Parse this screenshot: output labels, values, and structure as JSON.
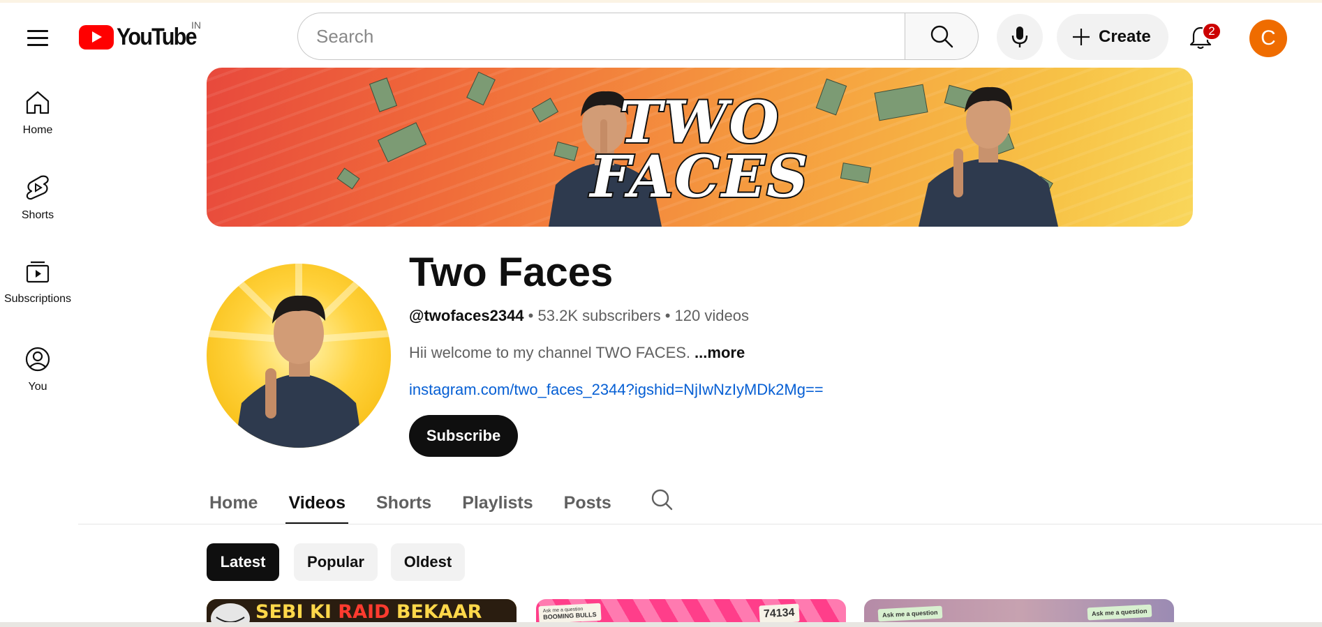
{
  "masthead": {
    "logo_text": "YouTube",
    "country_code": "IN",
    "search_placeholder": "Search",
    "create_label": "Create",
    "notification_count": "2",
    "avatar_letter": "C"
  },
  "guide": {
    "items": [
      {
        "label": "Home",
        "icon": "home-icon"
      },
      {
        "label": "Shorts",
        "icon": "shorts-icon"
      },
      {
        "label": "Subscriptions",
        "icon": "subscriptions-icon"
      },
      {
        "label": "You",
        "icon": "you-icon"
      }
    ]
  },
  "banner": {
    "title_line1": "TWO",
    "title_line2": "FACES"
  },
  "channel": {
    "name": "Two Faces",
    "handle": "@twofaces2344",
    "subscribers": "53.2K subscribers",
    "videos": "120 videos",
    "separator": "•",
    "description": "Hii welcome to my channel TWO FACES.",
    "more_label": "...more",
    "link": "instagram.com/two_faces_2344?igshid=NjIwNzIyMDk2Mg==",
    "subscribe_label": "Subscribe"
  },
  "tabs": [
    {
      "label": "Home",
      "active": false
    },
    {
      "label": "Videos",
      "active": true
    },
    {
      "label": "Shorts",
      "active": false
    },
    {
      "label": "Playlists",
      "active": false
    },
    {
      "label": "Posts",
      "active": false
    }
  ],
  "chips": [
    {
      "label": "Latest",
      "active": true
    },
    {
      "label": "Popular",
      "active": false
    },
    {
      "label": "Oldest",
      "active": false
    }
  ],
  "thumbnails": {
    "first_title_part1": "SEBI KI ",
    "first_title_raid": "RAID",
    "first_title_part2": " BEKAAR GAYI?",
    "second_note_left": "BOOMING BULLS",
    "second_note_right": "74134",
    "second_note_small": "Ask me a question",
    "third_note_left": "Ask me a question",
    "third_note_right": "Ask me a question"
  },
  "colors": {
    "brand_red": "#ff0000",
    "avatar_orange": "#ef6c00",
    "link_blue": "#065fd4"
  }
}
